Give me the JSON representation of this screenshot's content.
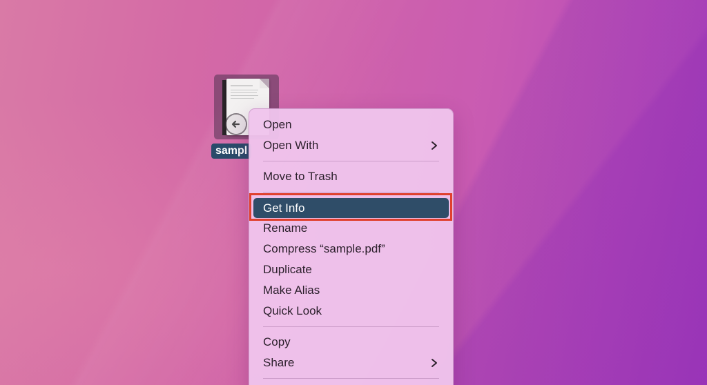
{
  "desktop": {
    "file": {
      "label": "sampl",
      "icon": "pdf-document-alias-icon"
    }
  },
  "context_menu": {
    "items": [
      {
        "label": "Open"
      },
      {
        "label": "Open With",
        "submenu_icon": "chevron-right-icon"
      },
      {
        "label": "Move to Trash"
      },
      {
        "label": "Get Info",
        "highlighted": true
      },
      {
        "label": "Rename"
      },
      {
        "label": "Compress “sample.pdf”"
      },
      {
        "label": "Duplicate"
      },
      {
        "label": "Make Alias"
      },
      {
        "label": "Quick Look"
      },
      {
        "label": "Copy"
      },
      {
        "label": "Share",
        "submenu_icon": "chevron-right-icon"
      }
    ]
  },
  "colors": {
    "highlight": "#2f4d68",
    "annotation": "#e0402d",
    "menu_bg": "#efc4ec"
  }
}
